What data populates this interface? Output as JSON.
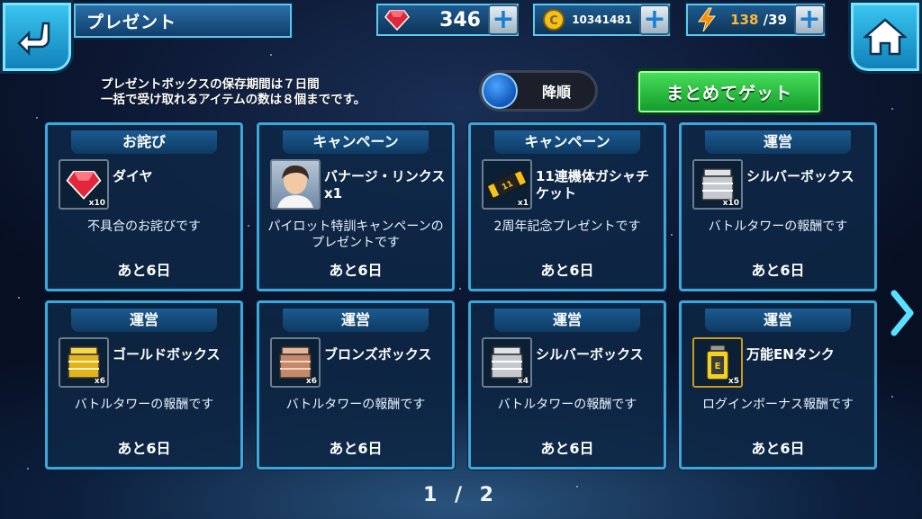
{
  "header": {
    "title": "プレゼント",
    "gems": "346",
    "coins": "10341481",
    "energy_current": "138",
    "energy_max": "/39"
  },
  "notice": {
    "line1": "プレゼントボックスの保存期間は７日間",
    "line2": "一括で受け取れるアイテムの数は８個までです。"
  },
  "sort_toggle": {
    "label": "降順"
  },
  "get_all_button": {
    "label": "まとめてゲット"
  },
  "presents": [
    {
      "category": "お詫び",
      "name": "ダイヤ",
      "qty": "x10",
      "icon": "gem-icon",
      "description": "不具合のお詫びです",
      "remaining": "あと6日"
    },
    {
      "category": "キャンペーン",
      "name": "バナージ・リンクスx1",
      "qty": "",
      "icon": "pilot-portrait-icon",
      "description": "パイロット特訓キャンペーンのプレゼントです",
      "remaining": "あと6日"
    },
    {
      "category": "キャンペーン",
      "name": "11連機体ガシャチケット",
      "qty": "x1",
      "icon": "gacha-ticket-icon",
      "description": "2周年記念プレゼントです",
      "remaining": "あと6日"
    },
    {
      "category": "運営",
      "name": "シルバーボックス",
      "qty": "x10",
      "icon": "silver-box-icon",
      "description": "バトルタワーの報酬です",
      "remaining": "あと6日"
    },
    {
      "category": "運営",
      "name": "ゴールドボックス",
      "qty": "x6",
      "icon": "gold-box-icon",
      "description": "バトルタワーの報酬です",
      "remaining": "あと6日"
    },
    {
      "category": "運営",
      "name": "ブロンズボックス",
      "qty": "x6",
      "icon": "bronze-box-icon",
      "description": "バトルタワーの報酬です",
      "remaining": "あと6日"
    },
    {
      "category": "運営",
      "name": "シルバーボックス",
      "qty": "x4",
      "icon": "silver-box-icon",
      "description": "バトルタワーの報酬です",
      "remaining": "あと6日"
    },
    {
      "category": "運営",
      "name": "万能ENタンク",
      "qty": "x5",
      "icon": "en-tank-icon",
      "description": "ログインボーナス報酬です",
      "remaining": "あと6日"
    }
  ],
  "pager": {
    "text": "1 / 2"
  },
  "colors": {
    "card_border": "#3fa6dd",
    "get_button": "#2fc447",
    "gem": "#e0283a",
    "energy": "#ffb838"
  }
}
